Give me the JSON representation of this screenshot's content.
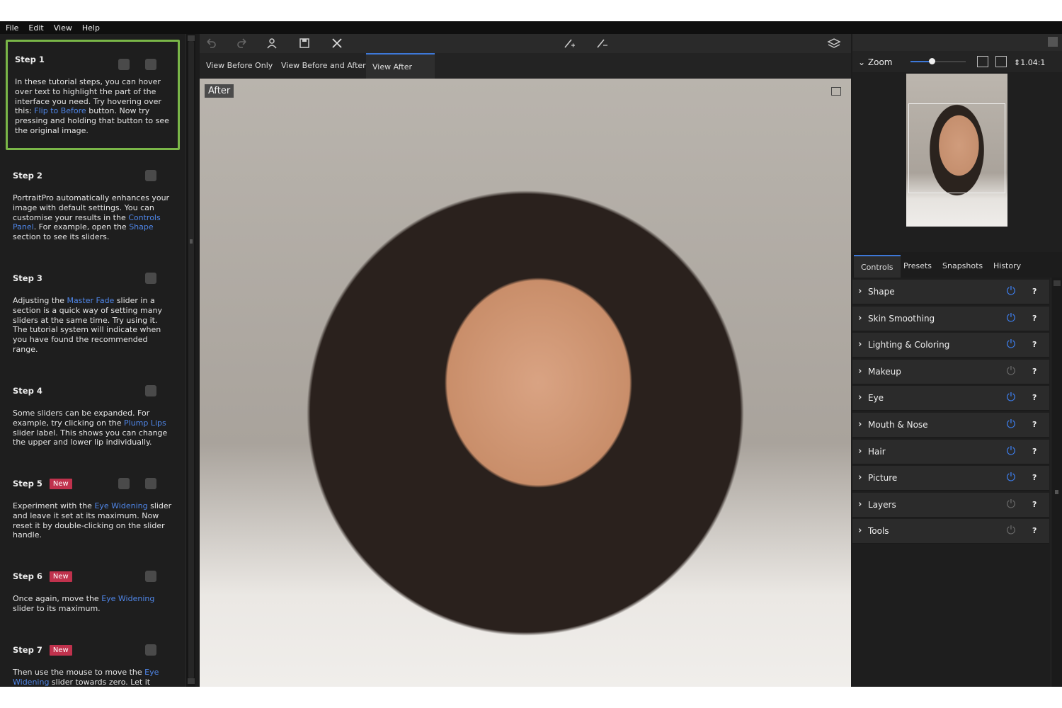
{
  "menu": [
    "File",
    "Edit",
    "View",
    "Help"
  ],
  "tutorial": {
    "steps": [
      {
        "title": "Step 1",
        "new": "",
        "parts": [
          {
            "t": "In these tutorial steps, you can hover over text to highlight the part of the interface you need. Try hovering over this: "
          },
          {
            "t": "Flip to Before",
            "h": true
          },
          {
            "t": " button. Now try pressing and holding that button to see the original image."
          }
        ]
      },
      {
        "title": "Step 2",
        "new": "",
        "parts": [
          {
            "t": "PortraitPro automatically enhances your image with default settings. You can customise your results in the "
          },
          {
            "t": "Controls Panel",
            "h": true
          },
          {
            "t": ". For example, open the "
          },
          {
            "t": "Shape",
            "h": true
          },
          {
            "t": " section to see its sliders."
          }
        ]
      },
      {
        "title": "Step 3",
        "new": "",
        "parts": [
          {
            "t": "Adjusting the "
          },
          {
            "t": "Master Fade",
            "h": true
          },
          {
            "t": " slider in a section is a quick way of setting many sliders at the same time. Try using it. The tutorial system will indicate when you have found the recommended range."
          }
        ]
      },
      {
        "title": "Step 4",
        "new": "",
        "parts": [
          {
            "t": "Some sliders can be expanded. For example, try clicking on the "
          },
          {
            "t": "Plump Lips",
            "h": true
          },
          {
            "t": " slider label. This shows you can change the upper and lower lip individually."
          }
        ]
      },
      {
        "title": "Step 5",
        "new": "New",
        "parts": [
          {
            "t": "Experiment with the "
          },
          {
            "t": "Eye Widening",
            "h": true
          },
          {
            "t": " slider and leave it set at its maximum. Now reset it by double-clicking on the slider handle."
          }
        ]
      },
      {
        "title": "Step 6",
        "new": "New",
        "parts": [
          {
            "t": "Once again, move the "
          },
          {
            "t": "Eye Widening",
            "h": true
          },
          {
            "t": " slider to its maximum."
          }
        ]
      },
      {
        "title": "Step 7",
        "new": "New",
        "parts": [
          {
            "t": "Then use the mouse to move the "
          },
          {
            "t": "Eye Widening",
            "h": true
          },
          {
            "t": " slider towards zero. Let it"
          }
        ]
      }
    ]
  },
  "toolbar": {
    "icons": [
      "undo-icon",
      "redo-icon",
      "person-icon",
      "save-icon",
      "close-icon",
      "brush-add-icon",
      "brush-remove-icon",
      "layers-icon"
    ]
  },
  "view_tabs": [
    {
      "label": "View Before Only",
      "active": false
    },
    {
      "label": "View Before and After",
      "active": false
    },
    {
      "label": "View After Only",
      "active": true
    }
  ],
  "image": {
    "label": "After"
  },
  "zoom": {
    "label": "Zoom",
    "value": "1.04:1",
    "slider_level": 0.35
  },
  "right_tabs": [
    {
      "label": "Controls",
      "active": true
    },
    {
      "label": "Presets",
      "active": false
    },
    {
      "label": "Snapshots",
      "active": false
    },
    {
      "label": "History",
      "active": false
    }
  ],
  "sections": [
    {
      "label": "Shape",
      "on": true
    },
    {
      "label": "Skin Smoothing",
      "on": true
    },
    {
      "label": "Lighting & Coloring",
      "on": true
    },
    {
      "label": "Makeup",
      "on": false
    },
    {
      "label": "Eye",
      "on": true
    },
    {
      "label": "Mouth & Nose",
      "on": true
    },
    {
      "label": "Hair",
      "on": true
    },
    {
      "label": "Picture",
      "on": true
    },
    {
      "label": "Layers",
      "on": false
    },
    {
      "label": "Tools",
      "on": false
    }
  ],
  "help_label": "?",
  "colors": {
    "accent": "#3d78d8",
    "power_on": "#3d7ff0",
    "power_off": "#6a6a6a",
    "active_step": "#7ab648",
    "new_badge": "#c0324d"
  }
}
